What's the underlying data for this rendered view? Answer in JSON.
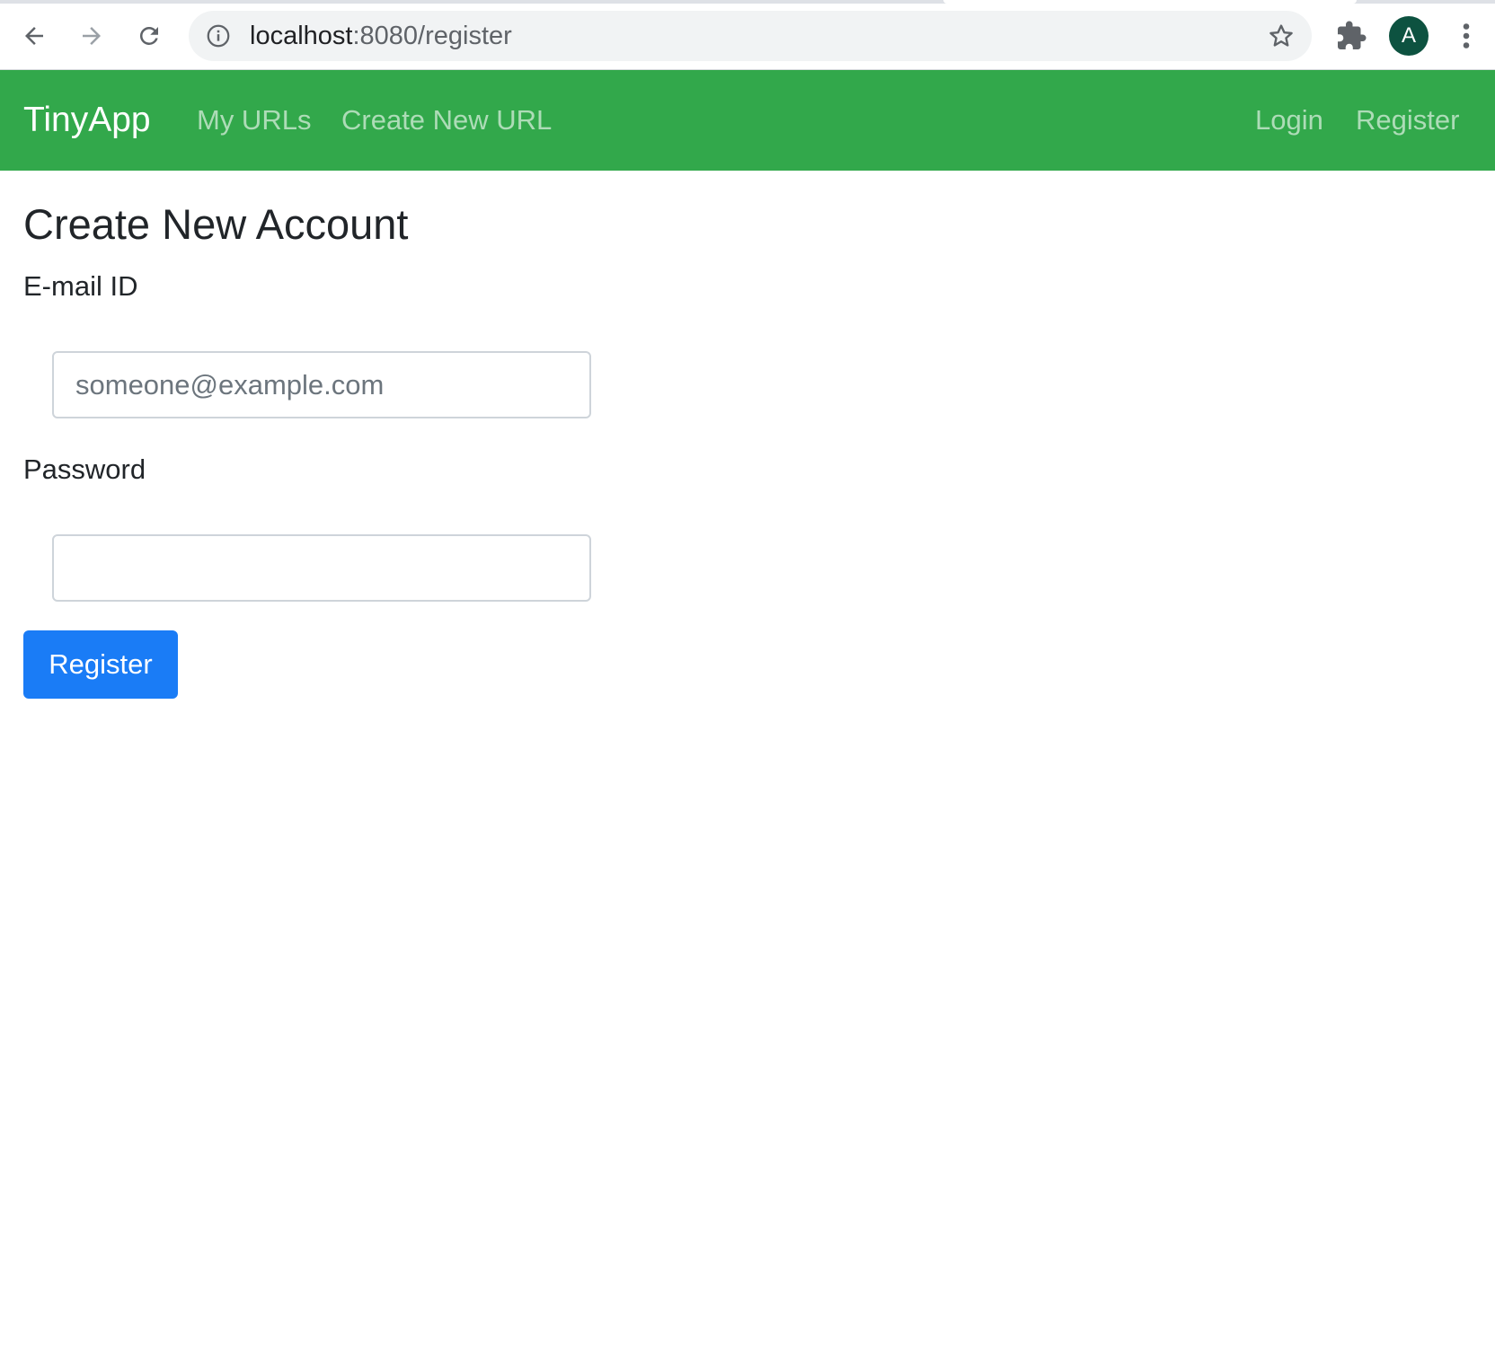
{
  "browser": {
    "url_host": "localhost",
    "url_path": ":8080/register",
    "avatar_letter": "A"
  },
  "navbar": {
    "brand": "TinyApp",
    "links": [
      {
        "label": "My URLs"
      },
      {
        "label": "Create New URL"
      }
    ],
    "auth_links": [
      {
        "label": "Login"
      },
      {
        "label": "Register"
      }
    ],
    "bg_color": "#32a84b"
  },
  "main": {
    "title": "Create New Account",
    "email": {
      "label": "E-mail ID",
      "placeholder": "someone@example.com",
      "value": ""
    },
    "password": {
      "label": "Password",
      "placeholder": "",
      "value": ""
    },
    "submit_label": "Register",
    "submit_color": "#1a7cf6"
  }
}
